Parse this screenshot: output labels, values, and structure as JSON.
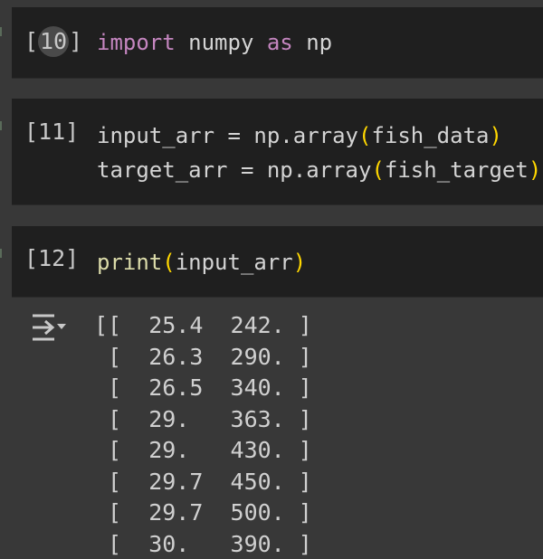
{
  "cells": [
    {
      "count": "10",
      "lines": [
        [
          {
            "t": "import",
            "c": "kw"
          },
          {
            "t": " numpy ",
            "c": ""
          },
          {
            "t": "as",
            "c": "kw"
          },
          {
            "t": " np",
            "c": ""
          }
        ]
      ]
    },
    {
      "count": "11",
      "lines": [
        [
          {
            "t": "input_arr = np.array",
            "c": ""
          },
          {
            "t": "(",
            "c": "paren"
          },
          {
            "t": "fish_data",
            "c": ""
          },
          {
            "t": ")",
            "c": "paren"
          }
        ],
        [
          {
            "t": "target_arr = np.array",
            "c": ""
          },
          {
            "t": "(",
            "c": "paren"
          },
          {
            "t": "fish_target",
            "c": ""
          },
          {
            "t": ")",
            "c": "paren"
          }
        ]
      ]
    },
    {
      "count": "12",
      "lines": [
        [
          {
            "t": "print",
            "c": "fn"
          },
          {
            "t": "(",
            "c": "paren"
          },
          {
            "t": "input_arr",
            "c": ""
          },
          {
            "t": ")",
            "c": "paren"
          }
        ]
      ]
    }
  ],
  "output": {
    "icon": "output-toggle-icon",
    "lines": [
      "[[  25.4  242. ]",
      " [  26.3  290. ]",
      " [  26.5  340. ]",
      " [  29.   363. ]",
      " [  29.   430. ]",
      " [  29.7  450. ]",
      " [  29.7  500. ]",
      " [  30.   390. ]"
    ]
  },
  "colors": {
    "page_bg": "#383838",
    "cell_bg": "#1f1f1f",
    "keyword": "#c586c0",
    "function": "#dcdcaa",
    "paren": "#ffd700",
    "text": "#d4d4d4"
  }
}
